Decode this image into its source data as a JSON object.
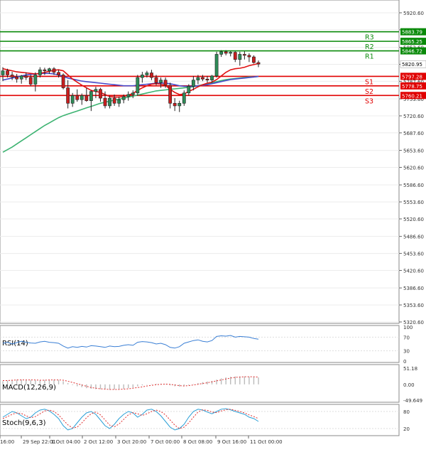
{
  "chart_data": {
    "type": "candlestick",
    "instrument_price": "5820.95",
    "price_axis": {
      "min": 5320.6,
      "max": 5920.6,
      "ticks": [
        "5920.60",
        "5887.60",
        "5853.60",
        "5820.60",
        "5787.60",
        "5753.60",
        "5720.60",
        "5687.60",
        "5653.60",
        "5620.60",
        "5586.60",
        "5553.60",
        "5520.60",
        "5486.60",
        "5453.60",
        "5420.60",
        "5386.60",
        "5353.60",
        "5320.60"
      ]
    },
    "x_labels": [
      "16:00",
      "29 Sep 22:01",
      "1 Oct 04:00",
      "2 Oct 12:00",
      "3 Oct 20:00",
      "7 Oct 00:00",
      "8 Oct 08:00",
      "9 Oct 16:00",
      "11 Oct 00:00"
    ],
    "levels": [
      {
        "name": "R3",
        "value": 5883.79,
        "label": "5883.79",
        "color": "#0a8a0a"
      },
      {
        "name": "R2",
        "value": 5865.25,
        "label": "5865.25",
        "color": "#0a8a0a"
      },
      {
        "name": "R1",
        "value": 5846.72,
        "label": "5846.72",
        "color": "#0a8a0a"
      },
      {
        "name": "S1",
        "value": 5797.28,
        "label": "5797.28",
        "color": "#e00000"
      },
      {
        "name": "S2",
        "value": 5778.75,
        "label": "5778.75",
        "color": "#e00000"
      },
      {
        "name": "S3",
        "value": 5760.21,
        "label": "5760.21",
        "color": "#e00000"
      }
    ],
    "candles": [
      {
        "o": 5800,
        "h": 5815,
        "l": 5788,
        "c": 5808
      },
      {
        "o": 5808,
        "h": 5812,
        "l": 5795,
        "c": 5800
      },
      {
        "o": 5800,
        "h": 5806,
        "l": 5790,
        "c": 5796
      },
      {
        "o": 5796,
        "h": 5802,
        "l": 5785,
        "c": 5792
      },
      {
        "o": 5792,
        "h": 5800,
        "l": 5783,
        "c": 5798
      },
      {
        "o": 5798,
        "h": 5805,
        "l": 5790,
        "c": 5795
      },
      {
        "o": 5795,
        "h": 5800,
        "l": 5778,
        "c": 5782
      },
      {
        "o": 5782,
        "h": 5805,
        "l": 5768,
        "c": 5800
      },
      {
        "o": 5800,
        "h": 5815,
        "l": 5795,
        "c": 5810
      },
      {
        "o": 5810,
        "h": 5814,
        "l": 5800,
        "c": 5808
      },
      {
        "o": 5808,
        "h": 5814,
        "l": 5802,
        "c": 5812
      },
      {
        "o": 5812,
        "h": 5815,
        "l": 5800,
        "c": 5805
      },
      {
        "o": 5805,
        "h": 5810,
        "l": 5795,
        "c": 5800
      },
      {
        "o": 5800,
        "h": 5803,
        "l": 5772,
        "c": 5775
      },
      {
        "o": 5775,
        "h": 5790,
        "l": 5735,
        "c": 5745
      },
      {
        "o": 5745,
        "h": 5765,
        "l": 5738,
        "c": 5760
      },
      {
        "o": 5760,
        "h": 5772,
        "l": 5748,
        "c": 5752
      },
      {
        "o": 5752,
        "h": 5764,
        "l": 5742,
        "c": 5760
      },
      {
        "o": 5760,
        "h": 5775,
        "l": 5748,
        "c": 5750
      },
      {
        "o": 5750,
        "h": 5770,
        "l": 5730,
        "c": 5768
      },
      {
        "o": 5768,
        "h": 5777,
        "l": 5755,
        "c": 5772
      },
      {
        "o": 5772,
        "h": 5775,
        "l": 5748,
        "c": 5755
      },
      {
        "o": 5755,
        "h": 5768,
        "l": 5735,
        "c": 5740
      },
      {
        "o": 5740,
        "h": 5760,
        "l": 5735,
        "c": 5755
      },
      {
        "o": 5755,
        "h": 5762,
        "l": 5740,
        "c": 5745
      },
      {
        "o": 5745,
        "h": 5758,
        "l": 5738,
        "c": 5752
      },
      {
        "o": 5752,
        "h": 5762,
        "l": 5745,
        "c": 5758
      },
      {
        "o": 5758,
        "h": 5768,
        "l": 5750,
        "c": 5762
      },
      {
        "o": 5762,
        "h": 5770,
        "l": 5755,
        "c": 5765
      },
      {
        "o": 5765,
        "h": 5800,
        "l": 5760,
        "c": 5795
      },
      {
        "o": 5795,
        "h": 5806,
        "l": 5785,
        "c": 5800
      },
      {
        "o": 5800,
        "h": 5808,
        "l": 5795,
        "c": 5804
      },
      {
        "o": 5804,
        "h": 5810,
        "l": 5790,
        "c": 5795
      },
      {
        "o": 5795,
        "h": 5800,
        "l": 5780,
        "c": 5785
      },
      {
        "o": 5785,
        "h": 5795,
        "l": 5775,
        "c": 5790
      },
      {
        "o": 5790,
        "h": 5795,
        "l": 5775,
        "c": 5780
      },
      {
        "o": 5780,
        "h": 5785,
        "l": 5735,
        "c": 5745
      },
      {
        "o": 5745,
        "h": 5755,
        "l": 5730,
        "c": 5740
      },
      {
        "o": 5740,
        "h": 5750,
        "l": 5728,
        "c": 5745
      },
      {
        "o": 5745,
        "h": 5770,
        "l": 5740,
        "c": 5765
      },
      {
        "o": 5765,
        "h": 5782,
        "l": 5760,
        "c": 5778
      },
      {
        "o": 5778,
        "h": 5798,
        "l": 5770,
        "c": 5790
      },
      {
        "o": 5790,
        "h": 5800,
        "l": 5782,
        "c": 5795
      },
      {
        "o": 5795,
        "h": 5800,
        "l": 5788,
        "c": 5792
      },
      {
        "o": 5792,
        "h": 5798,
        "l": 5785,
        "c": 5790
      },
      {
        "o": 5790,
        "h": 5800,
        "l": 5785,
        "c": 5798
      },
      {
        "o": 5798,
        "h": 5845,
        "l": 5795,
        "c": 5840
      },
      {
        "o": 5840,
        "h": 5848,
        "l": 5835,
        "c": 5845
      },
      {
        "o": 5845,
        "h": 5848,
        "l": 5838,
        "c": 5842
      },
      {
        "o": 5842,
        "h": 5846,
        "l": 5836,
        "c": 5844
      },
      {
        "o": 5844,
        "h": 5846,
        "l": 5825,
        "c": 5830
      },
      {
        "o": 5830,
        "h": 5845,
        "l": 5818,
        "c": 5840
      },
      {
        "o": 5840,
        "h": 5846,
        "l": 5830,
        "c": 5838
      },
      {
        "o": 5838,
        "h": 5842,
        "l": 5825,
        "c": 5835
      },
      {
        "o": 5835,
        "h": 5838,
        "l": 5822,
        "c": 5824
      },
      {
        "o": 5824,
        "h": 5828,
        "l": 5815,
        "c": 5821
      }
    ],
    "ma_red": [
      5812,
      5810,
      5808,
      5806,
      5805,
      5804,
      5803,
      5802,
      5803,
      5805,
      5807,
      5809,
      5810,
      5808,
      5800,
      5792,
      5786,
      5780,
      5775,
      5770,
      5768,
      5766,
      5762,
      5758,
      5757,
      5757,
      5758,
      5761,
      5764,
      5770,
      5775,
      5779,
      5782,
      5783,
      5782,
      5780,
      5772,
      5766,
      5762,
      5763,
      5768,
      5772,
      5777,
      5781,
      5784,
      5786,
      5791,
      5798,
      5805,
      5810,
      5812,
      5813,
      5815,
      5818,
      5820,
      5822
    ],
    "ma_blue": [
      5790,
      5792,
      5794,
      5796,
      5798,
      5800,
      5801,
      5802,
      5803,
      5803,
      5803,
      5802,
      5800,
      5797,
      5794,
      5792,
      5790,
      5788,
      5787,
      5786,
      5785,
      5784,
      5783,
      5782,
      5781,
      5780,
      5779,
      5779,
      5779,
      5780,
      5781,
      5782,
      5783,
      5784,
      5784,
      5784,
      5783,
      5781,
      5779,
      5778,
      5778,
      5778,
      5779,
      5780,
      5781,
      5783,
      5785,
      5787,
      5789,
      5791,
      5792,
      5793,
      5794,
      5795,
      5796,
      5797
    ],
    "ma_green": [
      5650,
      5655,
      5660,
      5666,
      5672,
      5678,
      5684,
      5690,
      5696,
      5702,
      5707,
      5712,
      5717,
      5721,
      5724,
      5727,
      5730,
      5733,
      5736,
      5739,
      5742,
      5745,
      5747,
      5749,
      5751,
      5753,
      5755,
      5757,
      5759,
      5761,
      5763,
      5765,
      5767,
      5769,
      5770,
      5771,
      5772,
      5773,
      5774,
      5775,
      5776,
      5777,
      5779,
      5781,
      5783,
      5785,
      5787,
      5789,
      5791,
      5792,
      5793,
      5794,
      5795,
      5796,
      5796,
      5797
    ],
    "rsi": {
      "label": "RSI(14)",
      "ticks": [
        "100",
        "70",
        "30",
        "0"
      ],
      "values": [
        52,
        55,
        50,
        54,
        58,
        55,
        53,
        52,
        56,
        58,
        55,
        54,
        52,
        44,
        38,
        42,
        40,
        43,
        41,
        45,
        44,
        42,
        40,
        44,
        42,
        43,
        46,
        48,
        46,
        55,
        57,
        56,
        54,
        50,
        52,
        48,
        40,
        38,
        42,
        52,
        56,
        60,
        62,
        58,
        56,
        60,
        72,
        74,
        73,
        75,
        70,
        72,
        71,
        70,
        66,
        64
      ]
    },
    "macd": {
      "label": "MACD(12,26,9)",
      "ticks": [
        "51.18",
        "0.00",
        "-49.649"
      ],
      "hist": [
        10,
        12,
        14,
        15,
        15,
        14,
        14,
        13,
        13,
        14,
        15,
        15,
        14,
        10,
        4,
        -2,
        -6,
        -9,
        -12,
        -14,
        -15,
        -15,
        -16,
        -17,
        -16,
        -15,
        -14,
        -12,
        -10,
        -6,
        -3,
        -1,
        1,
        2,
        2,
        1,
        -3,
        -6,
        -7,
        -5,
        -2,
        1,
        4,
        7,
        9,
        11,
        15,
        19,
        22,
        24,
        25,
        25,
        25,
        24,
        23,
        22
      ],
      "signal": [
        12,
        12,
        13,
        14,
        14,
        14,
        14,
        14,
        13,
        13,
        14,
        14,
        14,
        13,
        10,
        6,
        2,
        -2,
        -6,
        -10,
        -12,
        -14,
        -15,
        -16,
        -16,
        -16,
        -15,
        -14,
        -12,
        -10,
        -8,
        -5,
        -3,
        -1,
        0,
        1,
        0,
        -2,
        -4,
        -5,
        -4,
        -2,
        0,
        3,
        5,
        8,
        11,
        14,
        17,
        20,
        22,
        23,
        24,
        24,
        24,
        23
      ]
    },
    "stoch": {
      "label": "Stoch(9,6,3)",
      "ticks": [
        "80",
        "20"
      ],
      "k": [
        60,
        70,
        80,
        75,
        65,
        55,
        60,
        75,
        85,
        88,
        82,
        70,
        55,
        30,
        15,
        20,
        40,
        60,
        75,
        80,
        70,
        50,
        30,
        20,
        35,
        55,
        70,
        80,
        75,
        60,
        70,
        85,
        88,
        80,
        65,
        45,
        25,
        15,
        20,
        35,
        60,
        80,
        88,
        85,
        78,
        72,
        80,
        88,
        90,
        86,
        80,
        75,
        70,
        60,
        55,
        45
      ],
      "d": [
        55,
        62,
        70,
        75,
        73,
        65,
        58,
        62,
        72,
        82,
        85,
        80,
        68,
        50,
        33,
        22,
        25,
        40,
        58,
        72,
        78,
        68,
        50,
        32,
        26,
        36,
        52,
        68,
        76,
        72,
        66,
        72,
        80,
        85,
        80,
        68,
        50,
        32,
        20,
        25,
        40,
        60,
        78,
        86,
        84,
        78,
        76,
        82,
        86,
        88,
        84,
        80,
        75,
        68,
        62,
        55
      ]
    }
  }
}
